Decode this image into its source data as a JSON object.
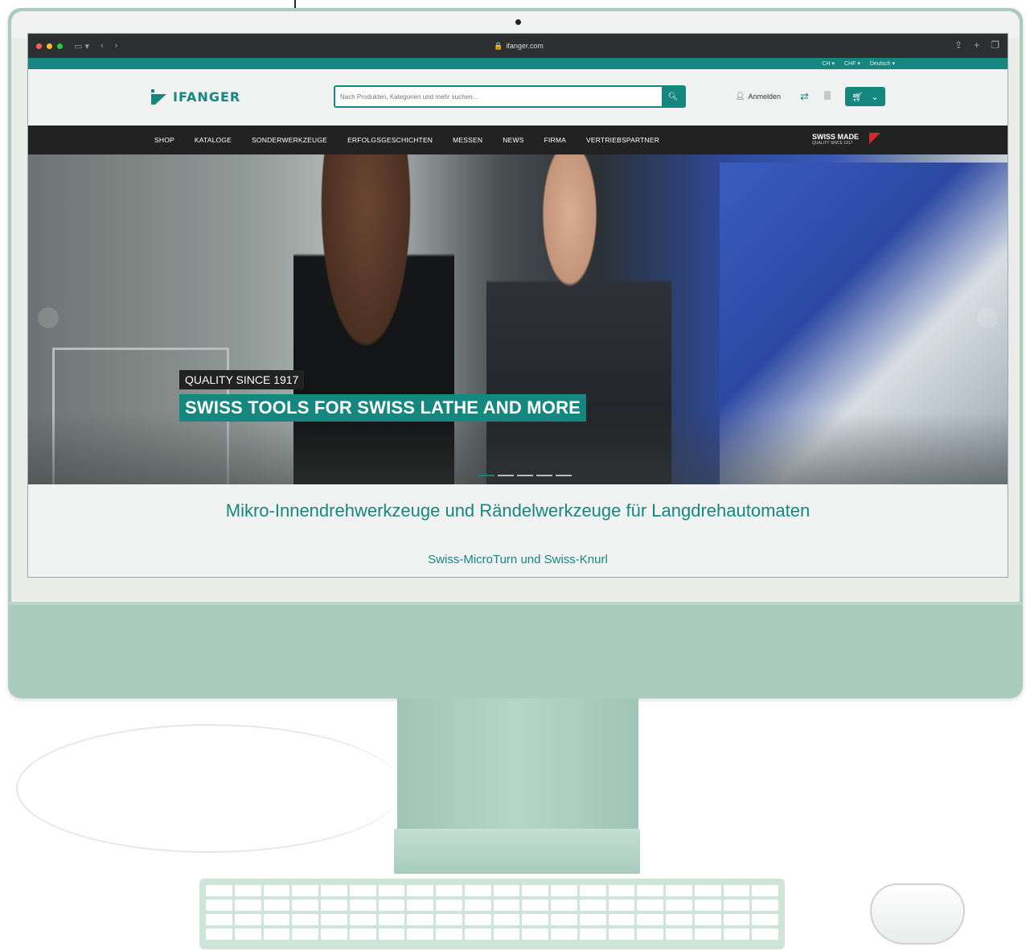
{
  "browser": {
    "url": "ifanger.com"
  },
  "topbar": {
    "country": "CH ▾",
    "currency": "CHF ▾",
    "language": "Deutsch ▾"
  },
  "header": {
    "logo_text": "IFANGER",
    "search_placeholder": "Nach Produkten, Kategorien und mehr suchen...",
    "login_label": "Anmelden"
  },
  "nav": {
    "items": [
      {
        "label": "SHOP"
      },
      {
        "label": "KATALOGE"
      },
      {
        "label": "SONDERWERKZEUGE"
      },
      {
        "label": "ERFOLGSGESCHICHTEN"
      },
      {
        "label": "MESSEN"
      },
      {
        "label": "NEWS"
      },
      {
        "label": "FIRMA"
      },
      {
        "label": "VERTRIEBSPARTNER"
      }
    ],
    "swiss_made": "SWISS MADE",
    "swiss_made_sub": "QUALITY SINCE 1917"
  },
  "hero": {
    "caption_top": "QUALITY SINCE 1917",
    "caption_main": "SWISS TOOLS FOR SWISS LATHE AND MORE",
    "slide_index": 0,
    "slide_count": 5
  },
  "content": {
    "heading": "Mikro-Innendrehwerkzeuge und Rändelwerkzeuge für Langdrehautomaten",
    "subheading": "Swiss-MicroTurn und Swiss-Knurl"
  },
  "colors": {
    "brand_teal": "#15877f",
    "nav_bg": "#222222",
    "imac_green": "#a9ccbf"
  }
}
